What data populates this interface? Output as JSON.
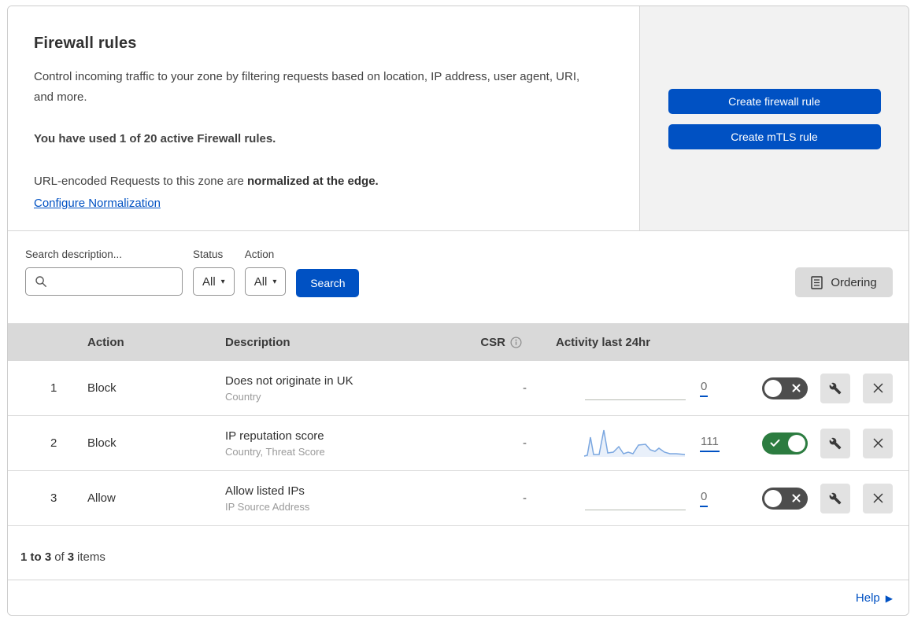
{
  "intro": {
    "title": "Firewall rules",
    "description": "Control incoming traffic to your zone by filtering requests based on location, IP address, user agent, URI, and more.",
    "usage": "You have used 1 of 20 active Firewall rules.",
    "normalization_prefix": "URL-encoded Requests to this zone are ",
    "normalization_bold": "normalized at the edge.",
    "normalization_link": "Configure Normalization"
  },
  "actions_panel": {
    "create_firewall_rule": "Create firewall rule",
    "create_mtls_rule": "Create mTLS rule"
  },
  "filters": {
    "search_label": "Search description...",
    "status_label": "Status",
    "status_value": "All",
    "action_label": "Action",
    "action_value": "All",
    "search_button": "Search",
    "ordering_button": "Ordering"
  },
  "table": {
    "headers": {
      "action": "Action",
      "description": "Description",
      "csr": "CSR",
      "activity": "Activity last 24hr"
    },
    "rows": [
      {
        "num": "1",
        "action": "Block",
        "description": "Does not originate in UK",
        "fields": "Country",
        "csr": "-",
        "activity_count": "0",
        "enabled": false,
        "has_sparkline": false
      },
      {
        "num": "2",
        "action": "Block",
        "description": "IP reputation score",
        "fields": "Country, Threat Score",
        "csr": "-",
        "activity_count": "111",
        "enabled": true,
        "has_sparkline": true
      },
      {
        "num": "3",
        "action": "Allow",
        "description": "Allow listed IPs",
        "fields": "IP Source Address",
        "csr": "-",
        "activity_count": "0",
        "enabled": false,
        "has_sparkline": false
      }
    ]
  },
  "pagination": {
    "range": "1 to 3",
    "of": "of",
    "total": "3",
    "items": "items"
  },
  "footer": {
    "help": "Help"
  },
  "colors": {
    "accent_blue": "#0051c3",
    "toggle_on_green": "#2c7c40",
    "toggle_off_gray": "#4d4d4d",
    "table_header_bg": "#d9d9d9",
    "panel_bg": "#f2f2f2",
    "sparkline_blue": "#7ba7e0"
  },
  "sparkline": {
    "width": 130,
    "height": 40,
    "baseline": 37,
    "points": [
      [
        1,
        36
      ],
      [
        5,
        35
      ],
      [
        9,
        12
      ],
      [
        13,
        34
      ],
      [
        20,
        34
      ],
      [
        26,
        3
      ],
      [
        31,
        32
      ],
      [
        38,
        31
      ],
      [
        45,
        24
      ],
      [
        51,
        33
      ],
      [
        57,
        31
      ],
      [
        63,
        33
      ],
      [
        70,
        22
      ],
      [
        79,
        21
      ],
      [
        85,
        28
      ],
      [
        91,
        30
      ],
      [
        96,
        26
      ],
      [
        103,
        31
      ],
      [
        110,
        33
      ],
      [
        118,
        33
      ],
      [
        129,
        34
      ]
    ]
  }
}
